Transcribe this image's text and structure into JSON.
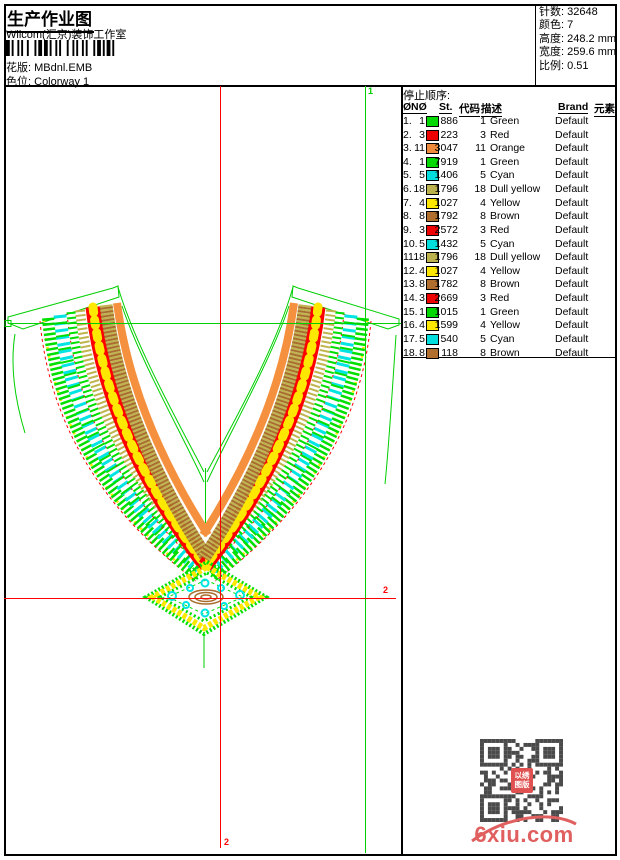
{
  "header": {
    "title": "生产作业图",
    "subtitle": "Wilcom(汇京)装饰工作室",
    "pattern_label": "花版:",
    "pattern_value": "MBdnl.EMB",
    "colorway_label": "色位:",
    "colorway_value": "Colorway 1",
    "stats": [
      {
        "label": "针数:",
        "value": "32648"
      },
      {
        "label": "颜色:",
        "value": "7"
      },
      {
        "label": "高度:",
        "value": "248.2 mm"
      },
      {
        "label": "宽度:",
        "value": "259.6 mm"
      },
      {
        "label": "比例:",
        "value": "0.51"
      }
    ]
  },
  "stop_table": {
    "title": "停止顺序:",
    "columns": [
      "Ø",
      "NØ",
      "St.",
      "代码",
      "描述",
      "Brand",
      "元素"
    ],
    "rows": [
      {
        "idx": "1.",
        "needle": "1",
        "color": "#00d800",
        "st": "886",
        "code": "1",
        "desc": "Green",
        "brand": "Default"
      },
      {
        "idx": "2.",
        "needle": "3",
        "color": "#ee0000",
        "st": "223",
        "code": "3",
        "desc": "Red",
        "brand": "Default"
      },
      {
        "idx": "3.",
        "needle": "11",
        "color": "#f08a3c",
        "st": "3047",
        "code": "11",
        "desc": "Orange",
        "brand": "Default"
      },
      {
        "idx": "4.",
        "needle": "1",
        "color": "#00d800",
        "st": "7919",
        "code": "1",
        "desc": "Green",
        "brand": "Default"
      },
      {
        "idx": "5.",
        "needle": "5",
        "color": "#00dede",
        "st": "1406",
        "code": "5",
        "desc": "Cyan",
        "brand": "Default"
      },
      {
        "idx": "6.",
        "needle": "18",
        "color": "#bcb24e",
        "st": "1796",
        "code": "18",
        "desc": "Dull yellow",
        "brand": "Default"
      },
      {
        "idx": "7.",
        "needle": "4",
        "color": "#ffe800",
        "st": "1027",
        "code": "4",
        "desc": "Yellow",
        "brand": "Default"
      },
      {
        "idx": "8.",
        "needle": "8",
        "color": "#b06f2f",
        "st": "1792",
        "code": "8",
        "desc": "Brown",
        "brand": "Default"
      },
      {
        "idx": "9.",
        "needle": "3",
        "color": "#ee0000",
        "st": "2572",
        "code": "3",
        "desc": "Red",
        "brand": "Default"
      },
      {
        "idx": "10.",
        "needle": "5",
        "color": "#00dede",
        "st": "1432",
        "code": "5",
        "desc": "Cyan",
        "brand": "Default"
      },
      {
        "idx": "11.",
        "needle": "18",
        "color": "#bcb24e",
        "st": "1796",
        "code": "18",
        "desc": "Dull yellow",
        "brand": "Default"
      },
      {
        "idx": "12.",
        "needle": "4",
        "color": "#ffe800",
        "st": "1027",
        "code": "4",
        "desc": "Yellow",
        "brand": "Default"
      },
      {
        "idx": "13.",
        "needle": "8",
        "color": "#b06f2f",
        "st": "1782",
        "code": "8",
        "desc": "Brown",
        "brand": "Default"
      },
      {
        "idx": "14.",
        "needle": "3",
        "color": "#ee0000",
        "st": "2669",
        "code": "3",
        "desc": "Red",
        "brand": "Default"
      },
      {
        "idx": "15.",
        "needle": "1",
        "color": "#00d800",
        "st": "1015",
        "code": "1",
        "desc": "Green",
        "brand": "Default"
      },
      {
        "idx": "16.",
        "needle": "4",
        "color": "#ffe800",
        "st": "1599",
        "code": "4",
        "desc": "Yellow",
        "brand": "Default"
      },
      {
        "idx": "17.",
        "needle": "5",
        "color": "#00dede",
        "st": "540",
        "code": "5",
        "desc": "Cyan",
        "brand": "Default"
      },
      {
        "idx": "18.",
        "needle": "8",
        "color": "#b06f2f",
        "st": "118",
        "code": "8",
        "desc": "Brown",
        "brand": "Default"
      }
    ]
  },
  "markers": {
    "start_label": "1",
    "end_label": "2"
  },
  "footer": {
    "site": "6xiu.com",
    "stamp_line1": "以绣",
    "stamp_line2": "图版"
  },
  "palette": {
    "outline_green": "#00cf00",
    "band_green": "#00e000",
    "red": "#ff0000",
    "orange": "#f5913e",
    "cyan": "#00e4e4",
    "dull_yellow": "#bfb44e",
    "yellow": "#ffe800",
    "brown": "#a86c2c",
    "qr_gray": "#4a4a4a",
    "site_red": "#e06060"
  }
}
